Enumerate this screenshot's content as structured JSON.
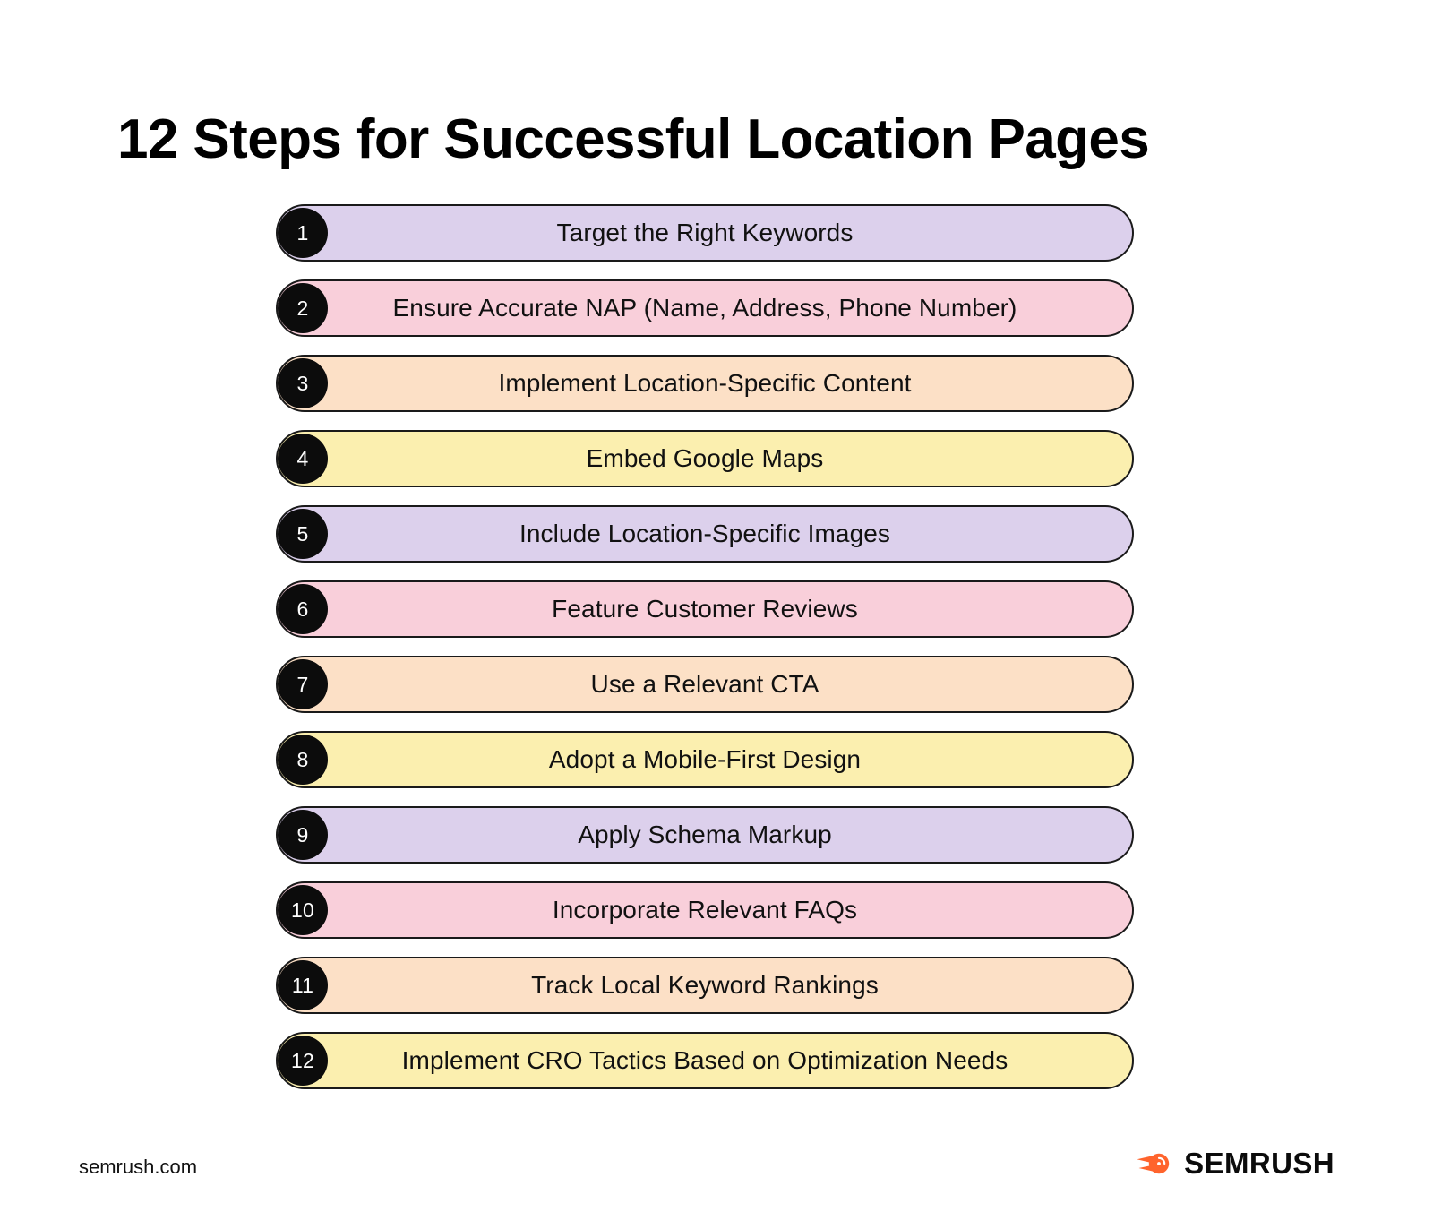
{
  "page": {
    "title": "12 Steps for Successful Location Pages",
    "background_color": "#FFFFFF"
  },
  "palette": {
    "purple": "#DCD0EC",
    "pink": "#F9CFDA",
    "peach": "#FCE0C6",
    "yellow": "#FBEFAF",
    "badge_fill": "#0C0C0C",
    "badge_text": "#FFFFFF",
    "border": "#1A1A1A",
    "text": "#111111",
    "brand_orange": "#FF642D"
  },
  "steps": [
    {
      "number": "1",
      "label": "Target the Right Keywords",
      "color": "#DCD0EC"
    },
    {
      "number": "2",
      "label": "Ensure Accurate NAP (Name, Address, Phone Number)",
      "color": "#F9CFDA"
    },
    {
      "number": "3",
      "label": "Implement Location-Specific Content",
      "color": "#FCE0C6"
    },
    {
      "number": "4",
      "label": "Embed Google Maps",
      "color": "#FBEFAF"
    },
    {
      "number": "5",
      "label": "Include Location-Specific Images",
      "color": "#DCD0EC"
    },
    {
      "number": "6",
      "label": "Feature Customer Reviews",
      "color": "#F9CFDA"
    },
    {
      "number": "7",
      "label": "Use a Relevant CTA",
      "color": "#FCE0C6"
    },
    {
      "number": "8",
      "label": "Adopt a Mobile-First Design",
      "color": "#FBEFAF"
    },
    {
      "number": "9",
      "label": "Apply Schema Markup",
      "color": "#DCD0EC"
    },
    {
      "number": "10",
      "label": "Incorporate Relevant FAQs",
      "color": "#F9CFDA"
    },
    {
      "number": "11",
      "label": "Track Local Keyword Rankings",
      "color": "#FCE0C6"
    },
    {
      "number": "12",
      "label": "Implement CRO Tactics Based on Optimization Needs",
      "color": "#FBEFAF"
    }
  ],
  "footer": {
    "url": "semrush.com",
    "logo_word": "SEMRUSH",
    "logo_icon": "semrush-comet-icon"
  }
}
